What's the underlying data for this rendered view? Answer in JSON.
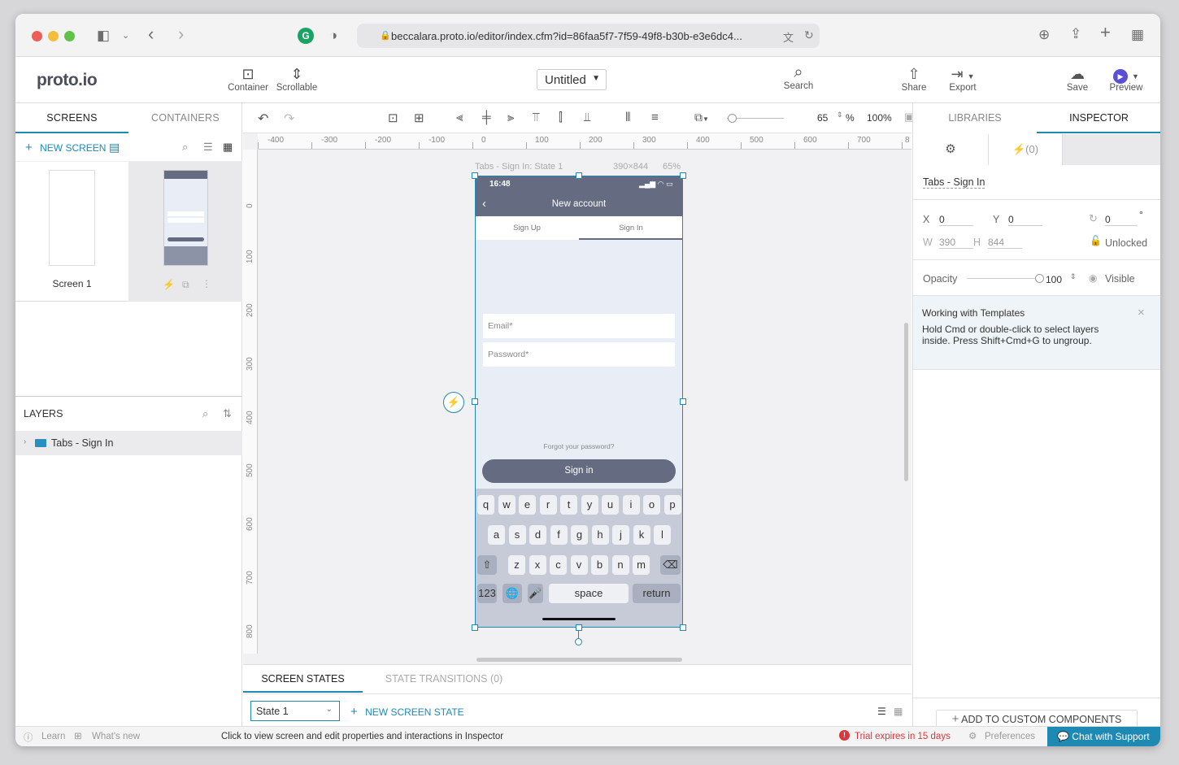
{
  "browser": {
    "url": "beccalara.proto.io/editor/index.cfm?id=86faa5f7-7f59-49f8-b30b-e3e6dc4..."
  },
  "header": {
    "logo": "proto.io",
    "container_label": "Container",
    "scrollable_label": "Scrollable",
    "project_title": "Untitled",
    "search_label": "Search",
    "share_label": "Share",
    "export_label": "Export",
    "save_label": "Save",
    "preview_label": "Preview"
  },
  "left": {
    "tab_screens": "SCREENS",
    "tab_containers": "CONTAINERS",
    "new_screen": "NEW SCREEN",
    "screen1_label": "Screen 1",
    "layers_title": "LAYERS",
    "layer_item": "Tabs - Sign In"
  },
  "toolbar": {
    "zoom_value": "65",
    "zoom_unit": "%",
    "zoom_fit": "100%"
  },
  "ruler": {
    "h": [
      "-400",
      "-300",
      "-200",
      "-100",
      "0",
      "100",
      "200",
      "300",
      "400",
      "500",
      "600",
      "700",
      "8"
    ],
    "v": [
      "0",
      "100",
      "200",
      "300",
      "400",
      "500",
      "600",
      "700",
      "800"
    ]
  },
  "canvas": {
    "frame_label": "Tabs - Sign In: State 1",
    "frame_size": "390×844",
    "frame_zoom": "65%"
  },
  "phone": {
    "time": "16:48",
    "title": "New account",
    "tab_signup": "Sign Up",
    "tab_signin": "Sign In",
    "email_placeholder": "Email*",
    "password_placeholder": "Password*",
    "forgot": "Forgot your password?",
    "signin_button": "Sign in",
    "kb_row1": [
      "q",
      "w",
      "e",
      "r",
      "t",
      "y",
      "u",
      "i",
      "o",
      "p"
    ],
    "kb_row2": [
      "a",
      "s",
      "d",
      "f",
      "g",
      "h",
      "j",
      "k",
      "l"
    ],
    "kb_row3": [
      "z",
      "x",
      "c",
      "v",
      "b",
      "n",
      "m"
    ],
    "kb_123": "123",
    "kb_space": "space",
    "kb_return": "return"
  },
  "inspector": {
    "tab_libraries": "LIBRARIES",
    "tab_inspector": "INSPECTOR",
    "interactions": "(0)",
    "element_name": "Tabs - Sign In",
    "x_label": "X",
    "x_value": "0",
    "y_label": "Y",
    "y_value": "0",
    "rotation_value": "0",
    "degree": "°",
    "w_label": "W",
    "w_value": "390",
    "h_label": "H",
    "h_value": "844",
    "lock_label": "Unlocked",
    "opacity_label": "Opacity",
    "opacity_value": "100",
    "visible_label": "Visible",
    "tip_title": "Working with Templates",
    "tip_text": "Hold Cmd or double-click to select layers inside. Press Shift+Cmd+G to ungroup.",
    "add_custom": "ADD TO CUSTOM COMPONENTS"
  },
  "bottom": {
    "tab_states": "SCREEN STATES",
    "tab_transitions": "STATE TRANSITIONS (0)",
    "state_select": "State 1",
    "new_state": "NEW SCREEN STATE"
  },
  "status": {
    "learn": "Learn",
    "whats_new": "What's new",
    "hint": "Click to view screen and edit properties and interactions in Inspector",
    "trial": "Trial expires in 15 days",
    "preferences": "Preferences",
    "chat": "Chat with Support"
  },
  "colors": {
    "accent": "#1e8ab4",
    "phone_header": "#656b80",
    "trial_red": "#d9363e"
  }
}
